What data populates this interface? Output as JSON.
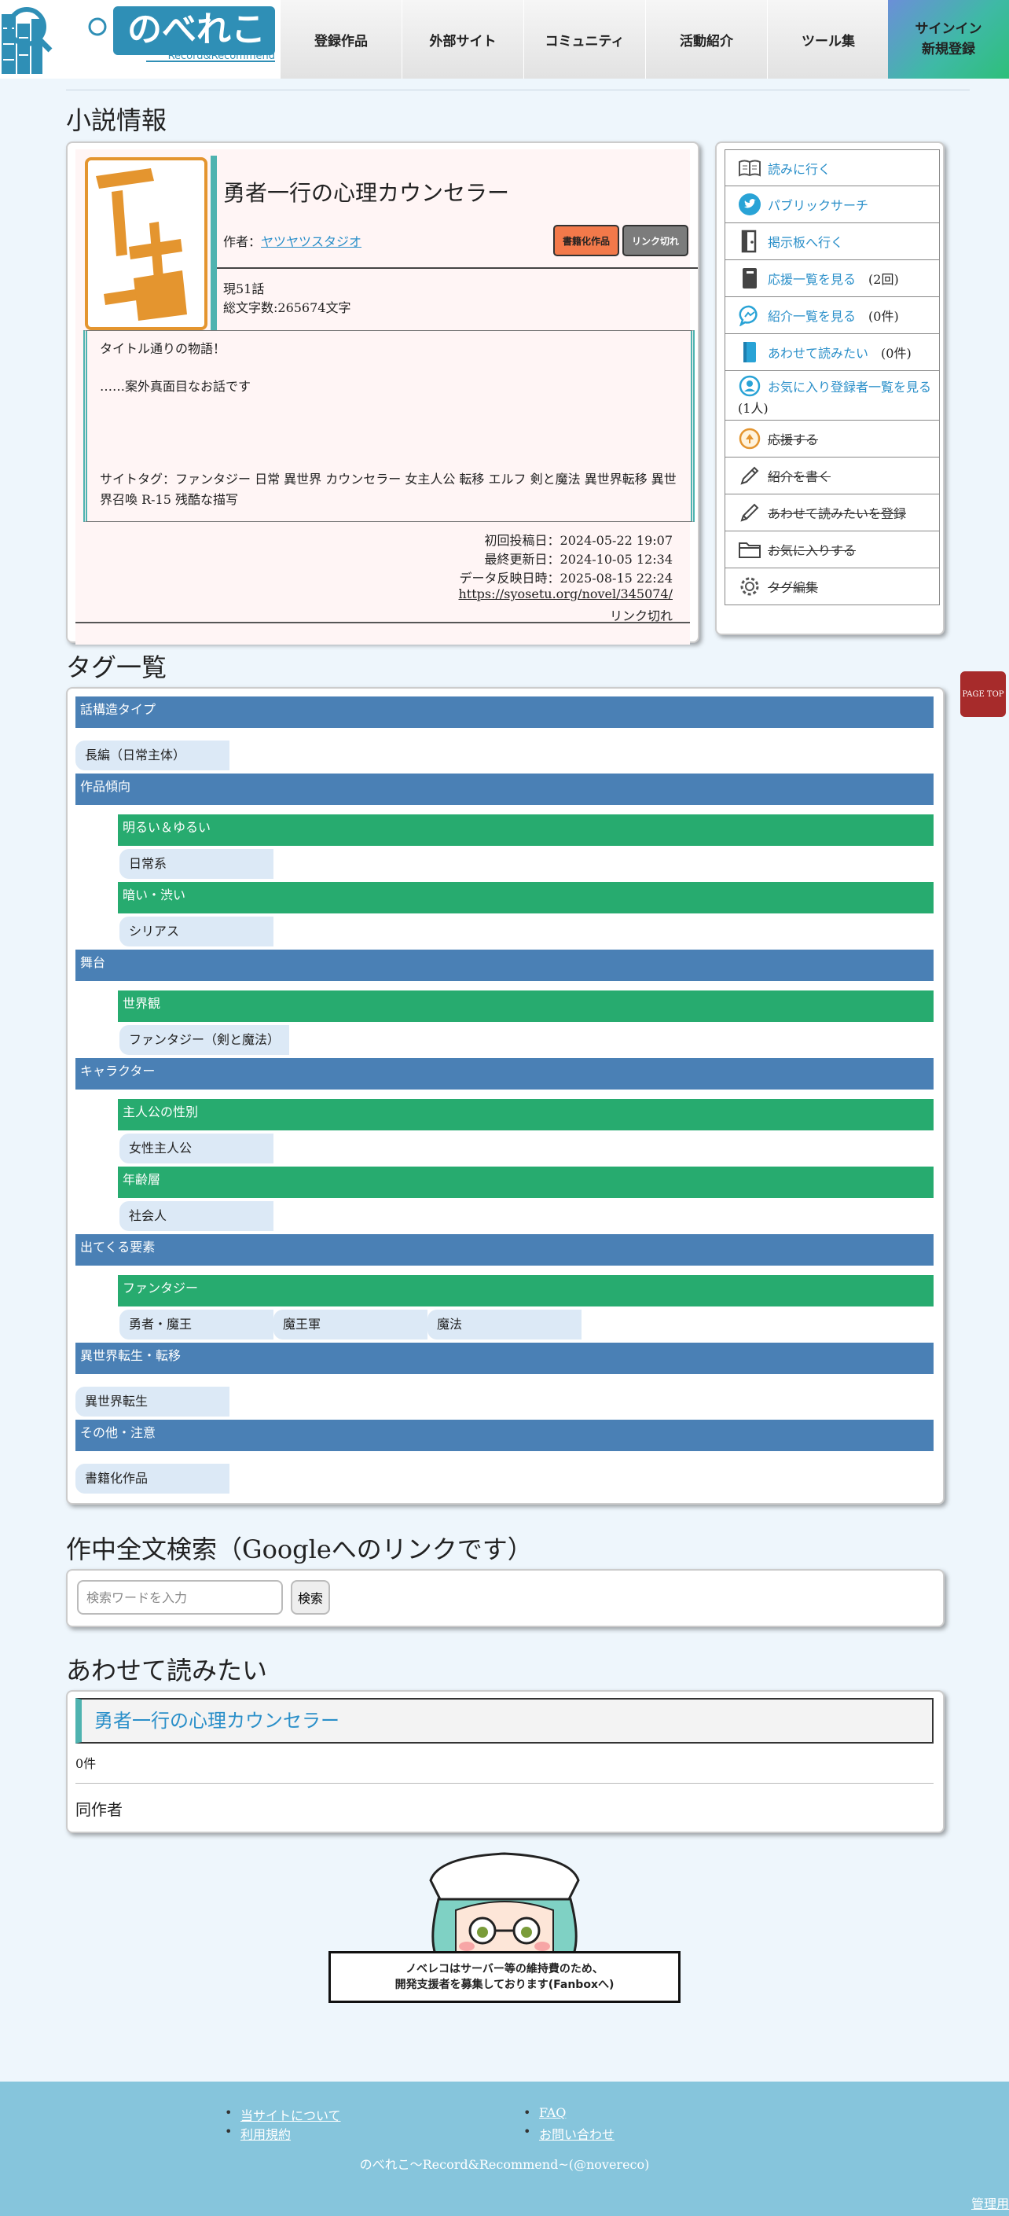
{
  "header": {
    "logo_text": "のべれこ",
    "logo_sub": "Record&Recommend",
    "nav": [
      "登録作品",
      "外部サイト",
      "コミュニティ",
      "活動紹介",
      "ツール集"
    ],
    "auth_signin": "サインイン",
    "auth_register": "新規登録"
  },
  "novel": {
    "section_title": "小説情報",
    "title": "勇者一行の心理カウンセラー",
    "author_label": "作者：",
    "author": "ヤツヤツスタジオ",
    "badge_book": "書籍化作品",
    "badge_link": "リンク切れ",
    "episodes": "現51話",
    "chars": "総文字数:265674文字",
    "synopsis_line1": "タイトル通りの物語！",
    "synopsis_line2": "……案外真面目なお話です",
    "site_tags": "サイトタグ：ファンタジー 日常 異世界 カウンセラー 女主人公 転移 エルフ 剣と魔法 異世界転移 異世界召喚 R-15 残酷な描写",
    "first_post": "初回投稿日：2024-05-22 19:07",
    "last_update": "最終更新日：2024-10-05 12:34",
    "data_reflect": "データ反映日時：2025-08-15 22:24",
    "url": "https://syosetu.org/novel/345074/",
    "link_status": "リンク切れ"
  },
  "menu": {
    "read": "読みに行く",
    "public_search": "パブリックサーチ",
    "board": "掲示板へ行く",
    "cheers": "応援一覧を見る",
    "cheers_count": "(2回)",
    "intros": "紹介一覧を見る",
    "intros_count": "(0件)",
    "read_together": "あわせて読みたい",
    "read_together_count": "(0件)",
    "fav_users": "お気に入り登録者一覧を見る",
    "fav_users_count": "(1人)",
    "cheer": "応援する",
    "write_intro": "紹介を書く",
    "register_together": "あわせて読みたいを登録",
    "favorite": "お気に入りする",
    "edit_tags": "タグ編集"
  },
  "tags": {
    "section_title": "タグ一覧",
    "c1": "話構造タイプ",
    "c1_t1": "長編（日常主体）",
    "c2": "作品傾向",
    "c2_s1": "明るい＆ゆるい",
    "c2_s1_t1": "日常系",
    "c2_s2": "暗い・渋い",
    "c2_s2_t1": "シリアス",
    "c3": "舞台",
    "c3_s1": "世界観",
    "c3_s1_t1": "ファンタジー（剣と魔法）",
    "c4": "キャラクター",
    "c4_s1": "主人公の性別",
    "c4_s1_t1": "女性主人公",
    "c4_s2": "年齢層",
    "c4_s2_t1": "社会人",
    "c5": "出てくる要素",
    "c5_s1": "ファンタジー",
    "c5_s1_t1": "勇者・魔王",
    "c5_s1_t2": "魔王軍",
    "c5_s1_t3": "魔法",
    "c6": "異世界転生・転移",
    "c6_t1": "異世界転生",
    "c7": "その他・注意",
    "c7_t1": "書籍化作品"
  },
  "search": {
    "section_title": "作中全文検索（Googleへのリンクです）",
    "placeholder": "検索ワードを入力",
    "button": "検索"
  },
  "recommend": {
    "section_title": "あわせて読みたい",
    "novel_title": "勇者一行の心理カウンセラー",
    "count": "0件",
    "same_author": "同作者"
  },
  "banner": {
    "line1": "ノベレコはサーバー等の維持費のため、",
    "line2": "開発支援者を募集しております(Fanboxへ)"
  },
  "page_top": "PAGE TOP",
  "footer": {
    "about": "当サイトについて",
    "terms": "利用規約",
    "faq": "FAQ",
    "contact": "お問い合わせ",
    "copy_prefix": "のべれこ～Record&Recommend~(",
    "copy_handle": "@novereco",
    "copy_suffix": ")",
    "admin": "管理用"
  },
  "colors": {
    "category_blue": "#4a80b5",
    "subcategory_green": "#27ab6f",
    "tag_bg": "#dce9f6",
    "accent_teal": "#4fb3b0",
    "link_blue": "#2a8fc9",
    "badge_orange": "#f3794a",
    "page_top_red": "#a72b2b",
    "footer_blue": "#86c5dc"
  }
}
